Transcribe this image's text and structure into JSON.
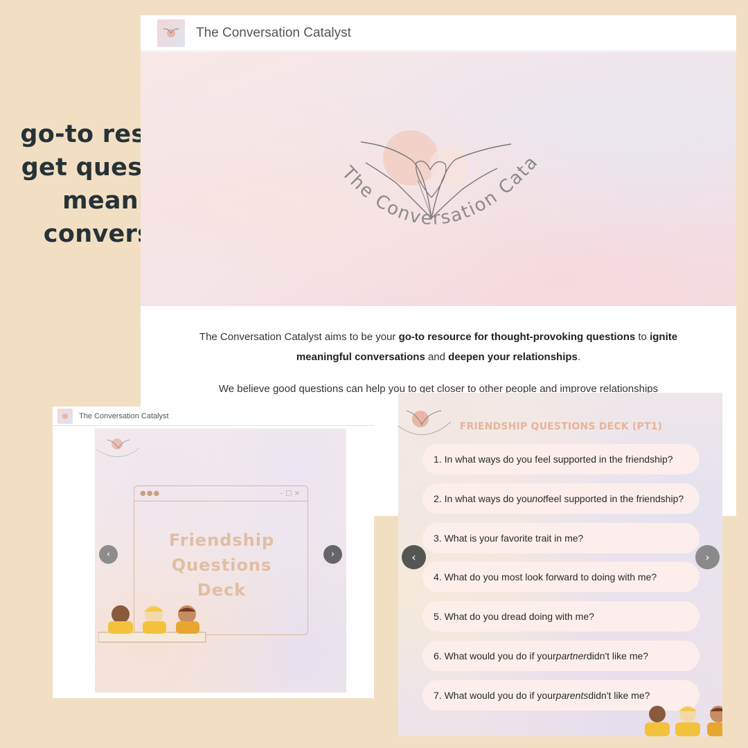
{
  "tagline": {
    "line1": "go-to resource to",
    "line2": "get questions for",
    "line3": "meaningful",
    "line4": "conversations"
  },
  "site": {
    "title": "The Conversation Catalyst",
    "logo_text": "The Conversation Catalyst"
  },
  "intro": {
    "p1_a": "The Conversation Catalyst aims to be your ",
    "p1_b": "go-to resource for thought-provoking questions",
    "p1_c": " to ",
    "p1_d": "ignite meaningful conversations",
    "p1_e": " and ",
    "p1_f": "deepen your relationships",
    "p1_g": ".",
    "p2": "We believe good questions can help you to get closer to other people and improve relationships"
  },
  "left_deck": {
    "header_title": "The Conversation Catalyst",
    "deck_title_1": "Friendship",
    "deck_title_2": "Questions",
    "deck_title_3": "Deck",
    "prev_icon": "‹",
    "next_icon": "›"
  },
  "questions_deck": {
    "title": "FRIENDSHIP QUESTIONS DECK (PT1)",
    "prev_icon": "‹",
    "next_icon": "›",
    "questions": [
      {
        "pre": "1. In what ways do you feel supported in the friendship?",
        "em": "",
        "post": ""
      },
      {
        "pre": "2. In what ways do you ",
        "em": "not",
        "post": " feel supported in the friendship?"
      },
      {
        "pre": "3. What is your favorite trait in me?",
        "em": "",
        "post": ""
      },
      {
        "pre": "4. What do you most look forward to doing with me?",
        "em": "",
        "post": ""
      },
      {
        "pre": "5. What do you dread doing with me?",
        "em": "",
        "post": ""
      },
      {
        "pre": "6. What would you do if your ",
        "em": "partner",
        "post": " didn't like me?"
      },
      {
        "pre": "7. What would you do if your ",
        "em": "parents",
        "post": " didn't like me?"
      }
    ]
  },
  "colors": {
    "background": "#f2dfc3",
    "tagline": "#263238",
    "deck_title": "#e1bea2",
    "questions_title": "#e6b49a"
  }
}
